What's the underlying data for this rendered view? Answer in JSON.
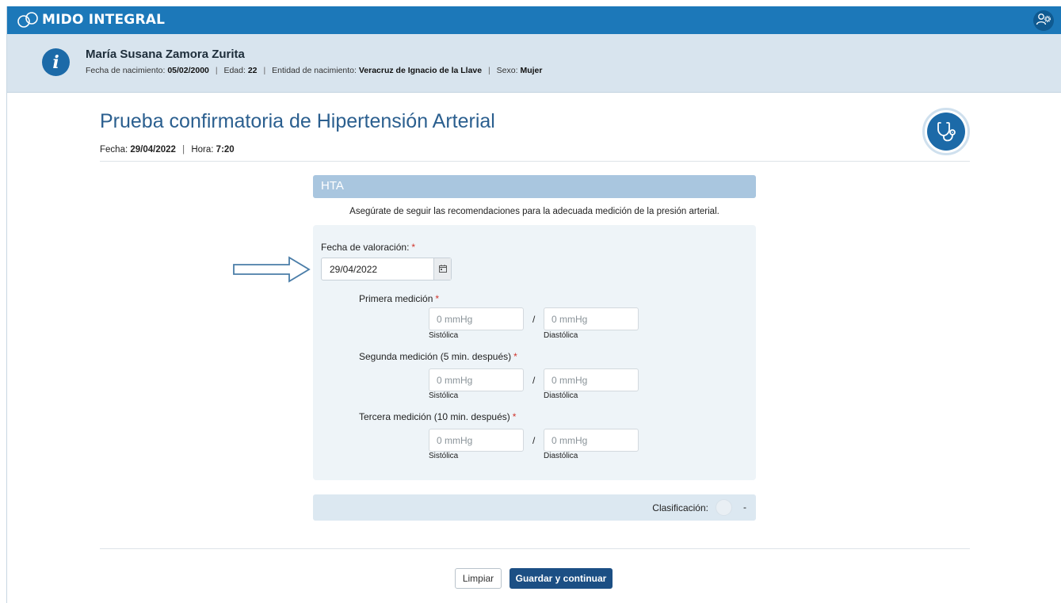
{
  "app": {
    "title": "MIDO INTEGRAL",
    "logo_icon": "infinity-link-icon",
    "user_icon": "user-settings-icon",
    "brand_color": "#1c78b9"
  },
  "patient": {
    "name": "María Susana Zamora Zurita",
    "birth_date_label": "Fecha de nacimiento:",
    "birth_date": "05/02/2000",
    "age_label": "Edad:",
    "age": "22",
    "birth_entity_label": "Entidad de nacimiento:",
    "birth_entity": "Veracruz de Ignacio de la Llave",
    "sex_label": "Sexo:",
    "sex": "Mujer",
    "separator": "|",
    "info_icon": "info-icon"
  },
  "page": {
    "title": "Prueba confirmatoria de Hipertensión Arterial",
    "date_label": "Fecha:",
    "date": "29/04/2022",
    "time_label": "Hora:",
    "time": "7:20",
    "separator": "|",
    "icon": "stethoscope-icon"
  },
  "section": {
    "title": "HTA",
    "advice": "Asegúrate de seguir las recomendaciones para la adecuada medición de la presión arterial."
  },
  "form": {
    "required_mark": "*",
    "assessment_date": {
      "label": "Fecha de valoración:",
      "value": "29/04/2022",
      "icon": "calendar-icon"
    },
    "measurements": [
      {
        "label": "Primera medición",
        "systolic_placeholder": "0 mmHg",
        "diastolic_placeholder": "0 mmHg",
        "systolic_label": "Sistólica",
        "diastolic_label": "Diastólica",
        "slash": "/"
      },
      {
        "label": "Segunda medición (5 min. después)",
        "systolic_placeholder": "0 mmHg",
        "diastolic_placeholder": "0 mmHg",
        "systolic_label": "Sistólica",
        "diastolic_label": "Diastólica",
        "slash": "/"
      },
      {
        "label": "Tercera medición (10 min. después)",
        "systolic_placeholder": "0 mmHg",
        "diastolic_placeholder": "0 mmHg",
        "systolic_label": "Sistólica",
        "diastolic_label": "Diastólica",
        "slash": "/"
      }
    ]
  },
  "classification": {
    "label": "Clasificación:",
    "value": "-"
  },
  "actions": {
    "clear_label": "Limpiar",
    "save_label": "Guardar y continuar"
  },
  "annotation": {
    "icon": "pointer-arrow-icon"
  }
}
